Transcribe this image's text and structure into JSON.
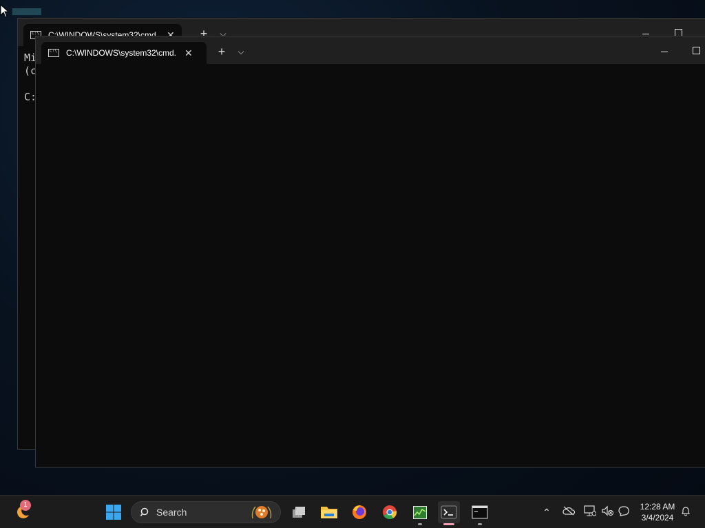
{
  "desktop": {
    "windows": [
      {
        "tab_title": "C:\\WINDOWS\\system32\\cmd.",
        "console_lines": [
          "Mi",
          "(c",
          "",
          "C:"
        ]
      },
      {
        "tab_title": "C:\\WINDOWS\\system32\\cmd.",
        "console_lines": []
      }
    ]
  },
  "taskbar": {
    "notification_badge": "1",
    "search_placeholder": "Search",
    "pinned_apps": [
      "Task View",
      "File Explorer",
      "Firefox",
      "Chrome",
      "Task Manager",
      "Terminal",
      "Command Prompt"
    ],
    "clock": {
      "time": "12:28 AM",
      "date": "3/4/2024"
    }
  },
  "colors": {
    "terminal_bg": "#0c0c0c",
    "titlebar_bg": "#202020",
    "taskbar_bg": "#1c1c1c",
    "active_indicator": "#f2a0b4"
  }
}
